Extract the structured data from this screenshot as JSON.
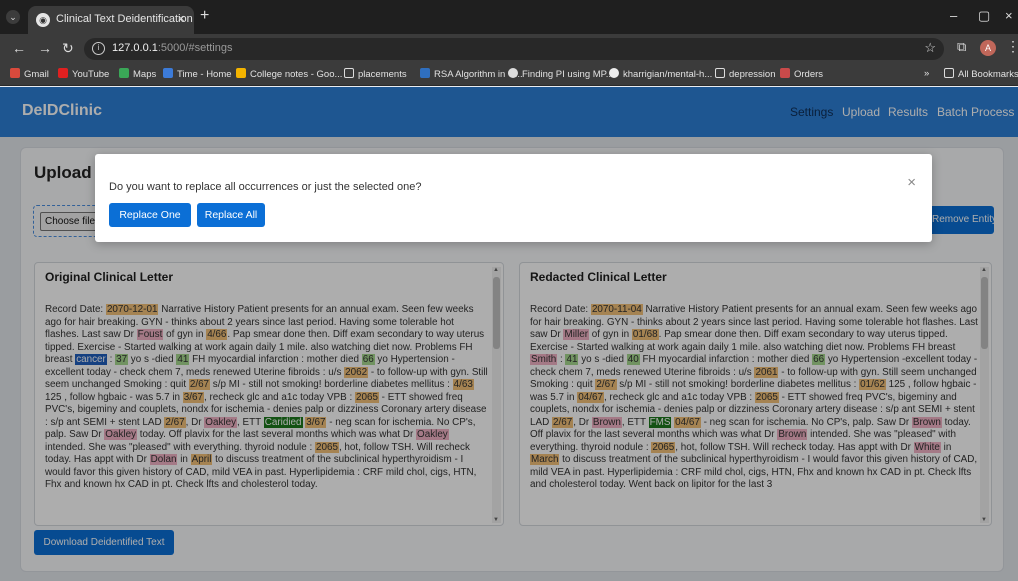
{
  "browser": {
    "tab_title": "Clinical Text Deidentification",
    "url_host": "127.0.0.1",
    "url_path": ":5000/#settings",
    "bookmarks": [
      "Gmail",
      "YouTube",
      "Maps",
      "Time - Home",
      "College notes - Goo...",
      "placements",
      "RSA Algorithm in C...",
      "Finding PI using MP...",
      "kharrigian/mental-h...",
      "depression",
      "Orders"
    ],
    "all_bookmarks": "All Bookmarks",
    "profile_initial": "A"
  },
  "app": {
    "brand": "DeIDClinic",
    "nav": [
      "Settings",
      "Upload",
      "Results",
      "Batch Process"
    ],
    "upload_title": "Upload and Deidentify",
    "choose_file": "Choose file",
    "remove_entity": "Remove Entity",
    "download": "Download Deidentified Text"
  },
  "panels": {
    "original_title": "Original Clinical Letter",
    "redacted_title": "Redacted Clinical Letter"
  },
  "modal": {
    "question": "Do you want to replace all occurrences or just the selected one?",
    "replace_one": "Replace One",
    "replace_all": "Replace All",
    "close": "×"
  },
  "colors": {
    "appbar": "#2d7fd6",
    "button": "#0b6fd6",
    "date_highlight": "#f3c27a",
    "name_highlight": "#f2b3c6",
    "age_highlight": "#a7d98f",
    "profession_highlight": "#1d7a1d"
  }
}
